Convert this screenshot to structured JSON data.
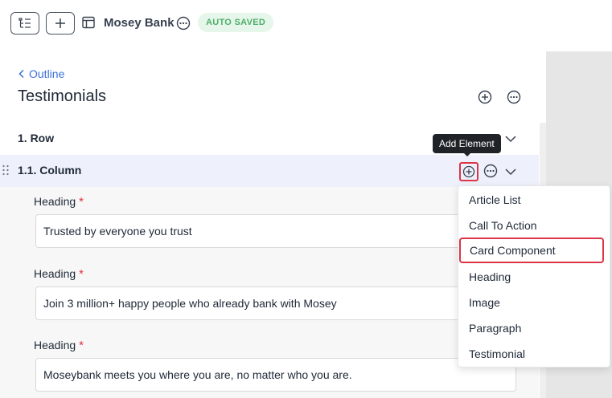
{
  "toolbar": {
    "app_title": "Mosey Bank",
    "status_badge": "AUTO SAVED",
    "icons": [
      "outline-icon",
      "plus-icon",
      "layout-icon",
      "more-icon"
    ]
  },
  "panel": {
    "back_label": "Outline",
    "title": "Testimonials",
    "row_label": "1. Row",
    "column_label": "1.1. Column"
  },
  "tooltip": {
    "text": "Add Element"
  },
  "fields": [
    {
      "label": "Heading",
      "required_mark": "*",
      "value": "Trusted by everyone you trust"
    },
    {
      "label": "Heading",
      "required_mark": "*",
      "value": "Join 3 million+ happy people who already bank with Mosey"
    },
    {
      "label": "Heading",
      "required_mark": "*",
      "value": "Moseybank meets you where you are, no matter who you are."
    }
  ],
  "menu": {
    "items": [
      "Article List",
      "Call To Action",
      "Card Component",
      "Heading",
      "Image",
      "Paragraph",
      "Testimonial"
    ],
    "highlighted": "Card Component"
  },
  "colors": {
    "accent_link": "#3b6fd8",
    "highlight_red": "#dc3545",
    "badge_green": "#4caf6a",
    "badge_bg": "#e7f6ea",
    "column_row_bg": "#eef1fb"
  }
}
